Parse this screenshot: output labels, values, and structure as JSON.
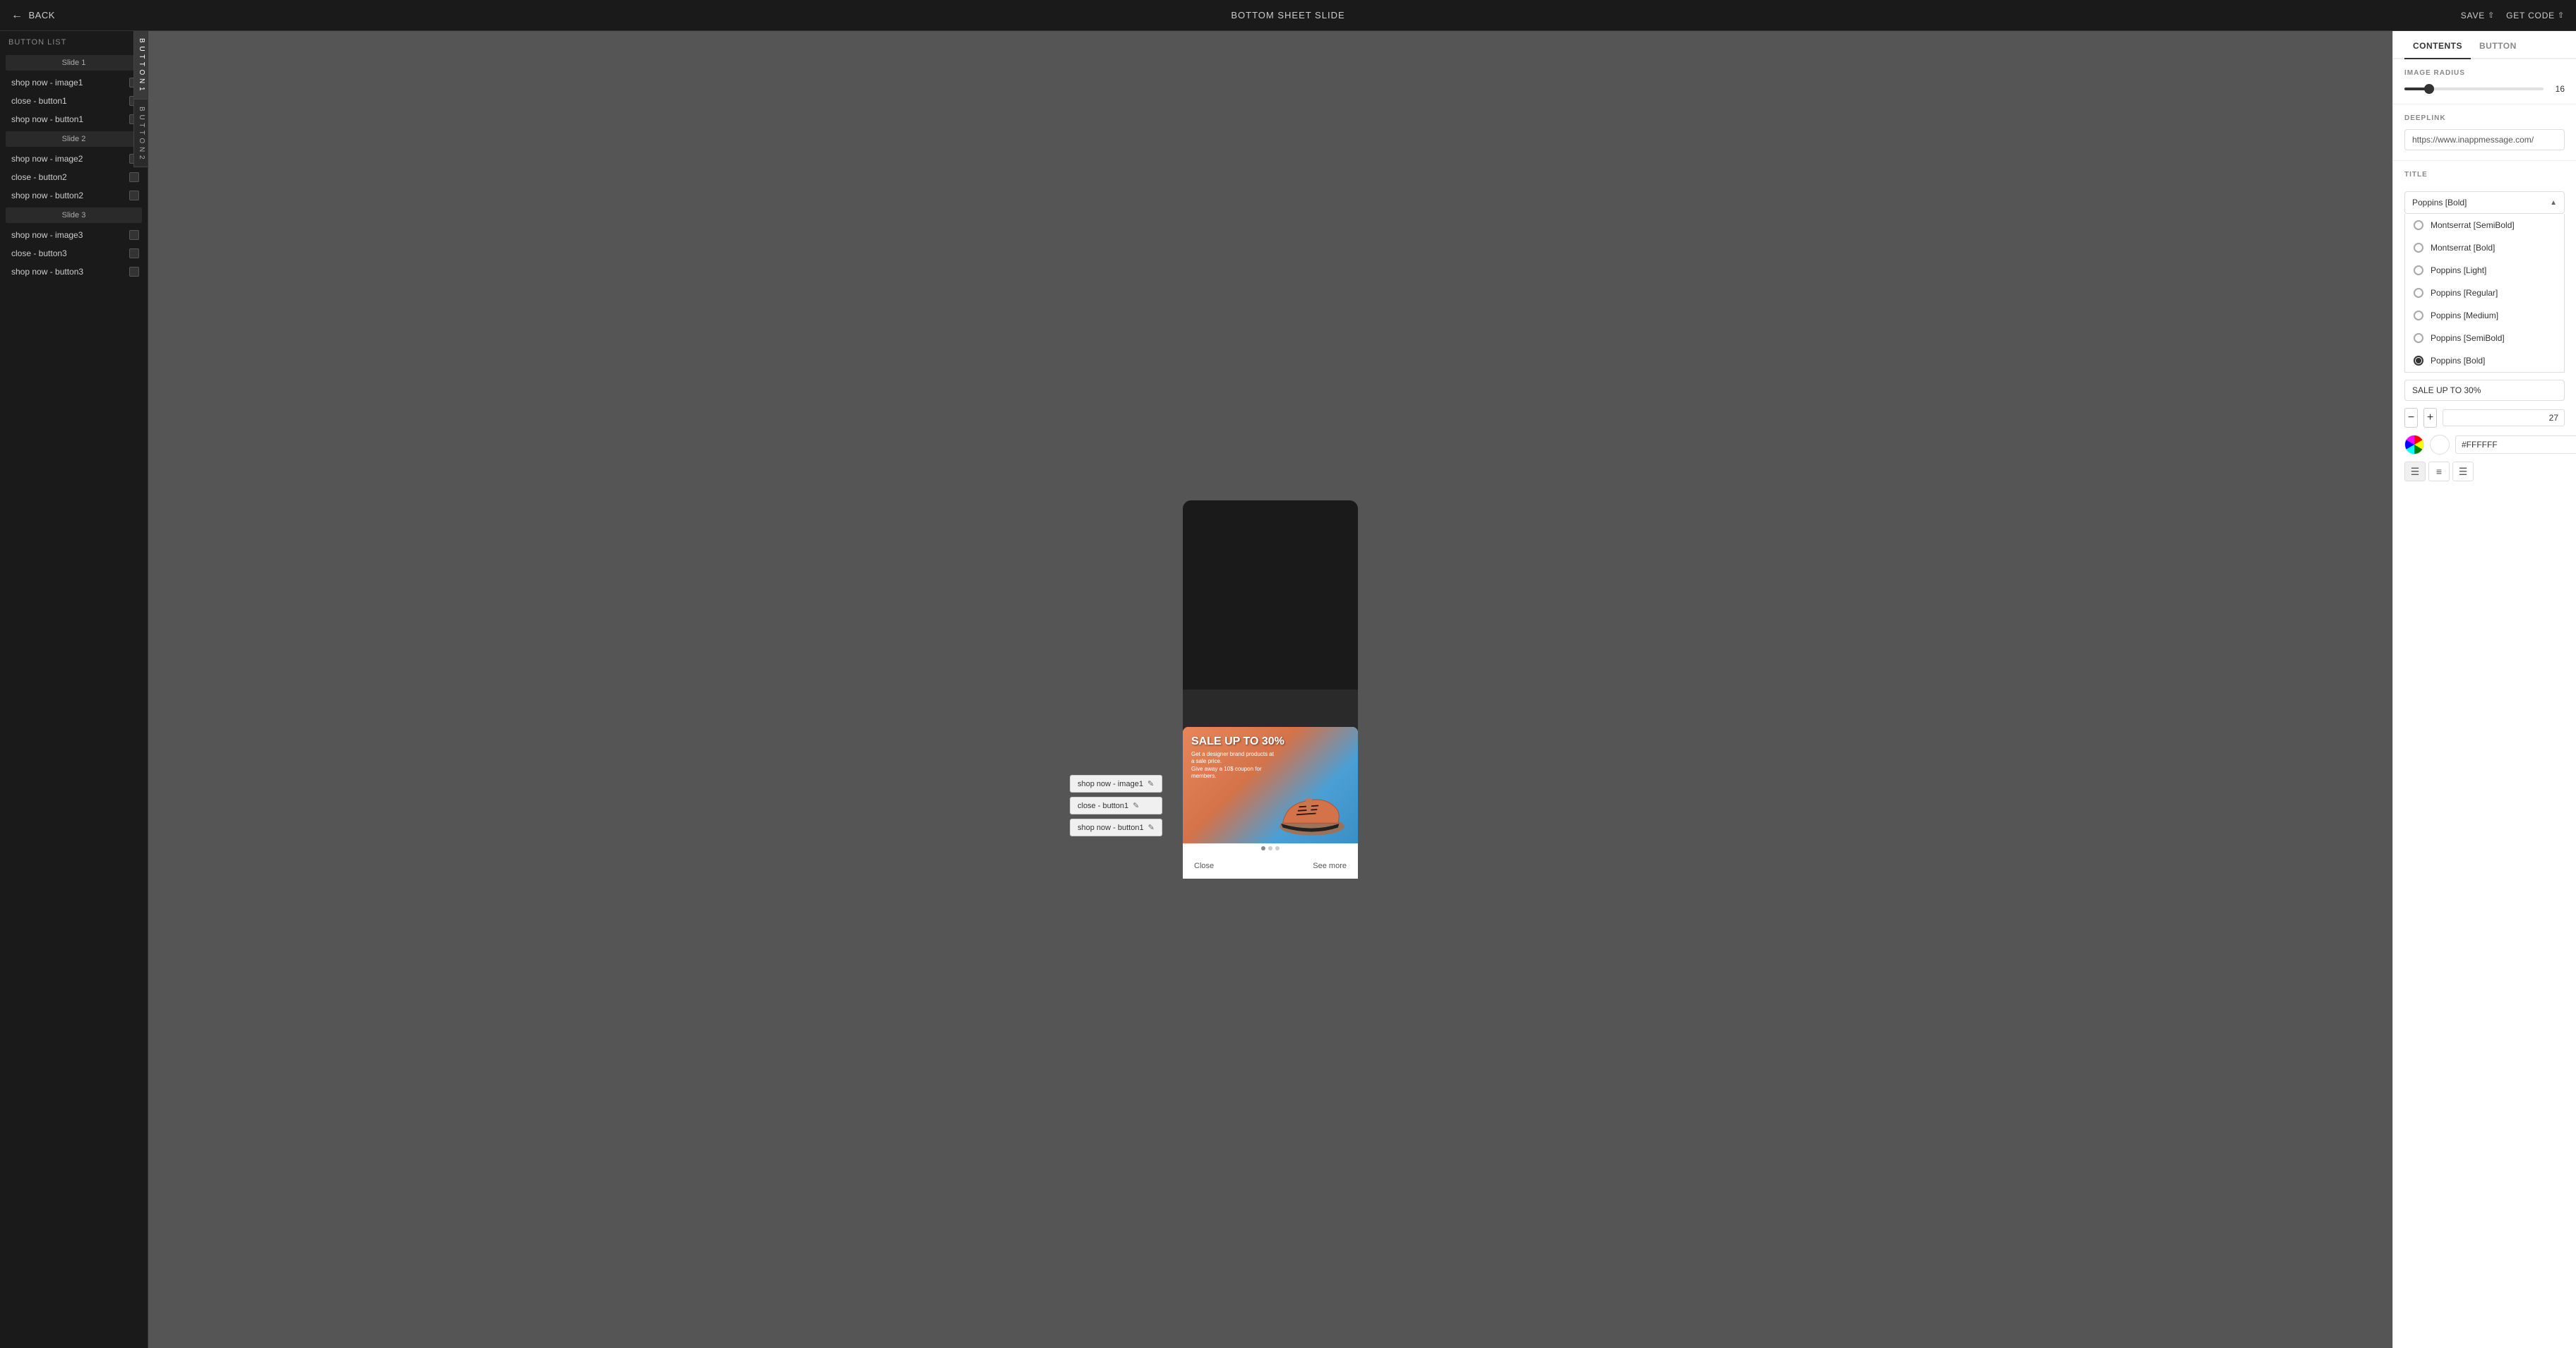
{
  "topBar": {
    "backLabel": "BACK",
    "title": "BOTTOM SHEET SLIDE",
    "saveLabel": "SAVE",
    "getCodeLabel": "GET CODE"
  },
  "sidebar": {
    "header": "BUTTON LIST",
    "button1Tab": "B\nU\nT\nT\nO\nN\n1",
    "button2Tab": "B\nU\nT\nT\nO\nN\n2",
    "slides": [
      {
        "label": "Slide 1",
        "items": [
          {
            "name": "shop now - image1",
            "checked": false
          },
          {
            "name": "close - button1",
            "checked": false
          },
          {
            "name": "shop now - button1",
            "checked": false
          }
        ]
      },
      {
        "label": "Slide 2",
        "items": [
          {
            "name": "shop now - image2",
            "checked": false
          },
          {
            "name": "close - button2",
            "checked": false
          },
          {
            "name": "shop now - button2",
            "checked": false
          }
        ]
      },
      {
        "label": "Slide 3",
        "items": [
          {
            "name": "shop now - image3",
            "checked": false
          },
          {
            "name": "close - button3",
            "checked": false
          },
          {
            "name": "shop now - button3",
            "checked": false
          }
        ]
      }
    ]
  },
  "canvas": {
    "floatingButtons": [
      {
        "label": "shop now - image1"
      },
      {
        "label": "close - button1"
      },
      {
        "label": "shop now - button1"
      }
    ],
    "sheet": {
      "saleTitle": "SALE UP TO 30%",
      "saleSubtitle": "Get a designer brand products at a sale price.\nGive away a 10$ coupon for members.",
      "dots": [
        true,
        false,
        false
      ],
      "closeBtn": "Close",
      "seeMoreBtn": "See more"
    }
  },
  "rightPanel": {
    "tabs": [
      "CONTENTS",
      "BUTTON"
    ],
    "activeTab": "CONTENTS",
    "imageRadius": {
      "label": "IMAGE RADIUS",
      "value": 16,
      "min": 0,
      "max": 100,
      "fillPercent": 16
    },
    "deeplink": {
      "label": "DEEPLINK",
      "value": "https://www.inappmessage.com/"
    },
    "title": {
      "label": "TITLE",
      "selectedFont": "Poppins [Bold]",
      "fontOptions": [
        {
          "name": "Montserrat [SemiBold]",
          "selected": false
        },
        {
          "name": "Montserrat [Bold]",
          "selected": false
        },
        {
          "name": "Poppins [Light]",
          "selected": false
        },
        {
          "name": "Poppins [Regular]",
          "selected": false
        },
        {
          "name": "Poppins [Medium]",
          "selected": false
        },
        {
          "name": "Poppins [SemiBold]",
          "selected": false
        },
        {
          "name": "Poppins [Bold]",
          "selected": true
        }
      ],
      "textValue": "SALE UP TO 30%",
      "fontSize": 27,
      "color": "#FFFFFF",
      "alignments": [
        "left",
        "center",
        "right"
      ]
    }
  }
}
